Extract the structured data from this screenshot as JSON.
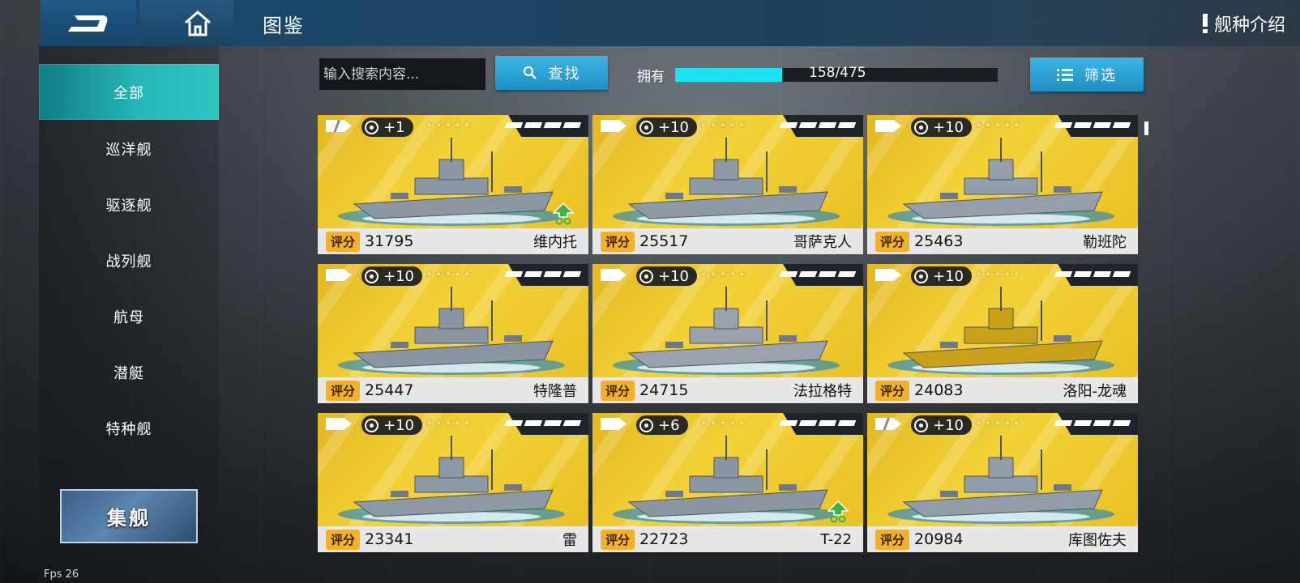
{
  "header": {
    "page_title": "图鉴",
    "intro_label": "舰种介绍"
  },
  "sidebar": {
    "items": [
      {
        "label": "全部",
        "active": true
      },
      {
        "label": "巡洋舰",
        "active": false
      },
      {
        "label": "驱逐舰",
        "active": false
      },
      {
        "label": "战列舰",
        "active": false
      },
      {
        "label": "航母",
        "active": false
      },
      {
        "label": "潜艇",
        "active": false
      },
      {
        "label": "特种舰",
        "active": false
      }
    ],
    "collect_label": "集舰",
    "fps_label": "Fps 26"
  },
  "toolbar": {
    "search_placeholder": "输入搜索内容...",
    "search_label": "查找",
    "own_label": "拥有",
    "own_count": "158/475",
    "own_fraction": 0.3326,
    "filter_label": "筛选"
  },
  "colors": {
    "accent_teal": "#2ec6c2",
    "button_blue": "#1f8fc4",
    "progress": "#1ee2f4",
    "card_gold": "#f3d238",
    "score_tag": "#f2b12a"
  },
  "cards": [
    {
      "name": "维内托",
      "score_tag": "评分",
      "score": "31795",
      "level": "+1",
      "stars": "★★★★★",
      "class_icon": "split-tag-icon",
      "upgrade": true
    },
    {
      "name": "哥萨克人",
      "score_tag": "评分",
      "score": "25517",
      "level": "+10",
      "stars": "★★★★★",
      "class_icon": "tag-icon",
      "upgrade": false
    },
    {
      "name": "勒班陀",
      "score_tag": "评分",
      "score": "25463",
      "level": "+10",
      "stars": "★★★★★",
      "class_icon": "tag-icon",
      "upgrade": false
    },
    {
      "name": "特隆普",
      "score_tag": "评分",
      "score": "25447",
      "level": "+10",
      "stars": "★★★★★",
      "class_icon": "tag-icon",
      "upgrade": false
    },
    {
      "name": "法拉格特",
      "score_tag": "评分",
      "score": "24715",
      "level": "+10",
      "stars": "★★★★★",
      "class_icon": "tag-icon",
      "upgrade": false
    },
    {
      "name": "洛阳-龙魂",
      "score_tag": "评分",
      "score": "24083",
      "level": "+10",
      "stars": "★★★★★",
      "class_icon": "tag-icon",
      "upgrade": false
    },
    {
      "name": "雷",
      "score_tag": "评分",
      "score": "23341",
      "level": "+10",
      "stars": "★★★★★",
      "class_icon": "tag-icon",
      "upgrade": false
    },
    {
      "name": "T-22",
      "score_tag": "评分",
      "score": "22723",
      "level": "+6",
      "stars": "★★★★★",
      "class_icon": "tag-icon",
      "upgrade": true
    },
    {
      "name": "库图佐夫",
      "score_tag": "评分",
      "score": "20984",
      "level": "+10",
      "stars": "★★★★★",
      "class_icon": "split-tag-icon",
      "upgrade": false
    }
  ]
}
